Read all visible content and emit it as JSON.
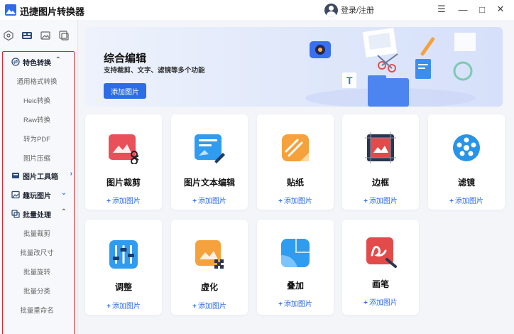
{
  "app": {
    "title": "迅捷图片转换器"
  },
  "header": {
    "login_label": "登录/注册"
  },
  "window_controls": {
    "menu": "☰",
    "minimize": "—",
    "maximize": "□",
    "close": "✕"
  },
  "sidebar": {
    "sections": [
      {
        "label": "特色转换",
        "expanded": true,
        "items": [
          "通用格式转换",
          "Heic转换",
          "Raw转换",
          "转为PDF",
          "图片压缩"
        ]
      },
      {
        "label": "图片工具箱",
        "expanded": false,
        "items": []
      },
      {
        "label": "趣玩图片",
        "expanded": false,
        "items": []
      },
      {
        "label": "批量处理",
        "expanded": true,
        "items": [
          "批量裁剪",
          "批量改尺寸",
          "批量旋转",
          "批量分类",
          "批量重命名"
        ]
      }
    ]
  },
  "banner": {
    "title": "综合编辑",
    "subtitle": "支持裁剪、文字、滤镜等多个功能",
    "button_label": "添加图片"
  },
  "tools": [
    {
      "label": "图片裁剪",
      "add": "添加图片",
      "icon": "crop-icon",
      "color": "#e9505a"
    },
    {
      "label": "图片文本编辑",
      "add": "添加图片",
      "icon": "text-edit-icon",
      "color": "#2f9cf0"
    },
    {
      "label": "贴纸",
      "add": "添加图片",
      "icon": "sticker-icon",
      "color": "#f5a13c"
    },
    {
      "label": "边框",
      "add": "添加图片",
      "icon": "border-icon",
      "color": "#e34a4a"
    },
    {
      "label": "滤镜",
      "add": "添加图片",
      "icon": "filter-icon",
      "color": "#2894e8"
    },
    {
      "label": "调整",
      "add": "添加图片",
      "icon": "adjust-icon",
      "color": "#2f9cf0"
    },
    {
      "label": "虚化",
      "add": "添加图片",
      "icon": "blur-icon",
      "color": "#f5a13c"
    },
    {
      "label": "叠加",
      "add": "添加图片",
      "icon": "overlay-icon",
      "color": "#2f9cf0"
    },
    {
      "label": "画笔",
      "add": "添加图片",
      "icon": "brush-icon",
      "color": "#e34a4a"
    }
  ],
  "colors": {
    "accent": "#2e6ce6",
    "highlight_box": "#e0242c"
  }
}
